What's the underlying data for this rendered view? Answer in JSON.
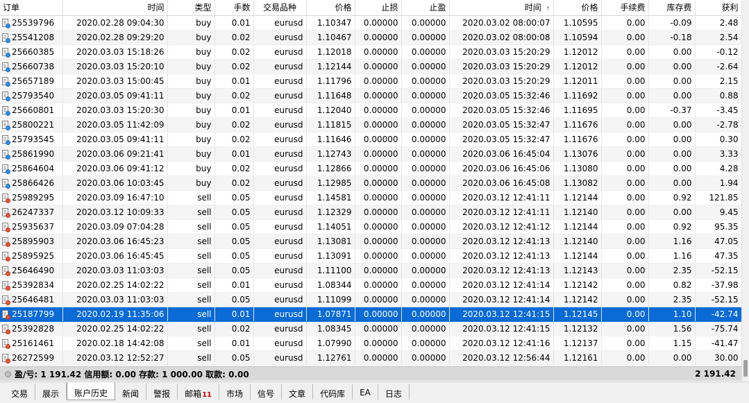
{
  "columns": [
    "订单",
    "时间",
    "类型",
    "手数",
    "交易品种",
    "价格",
    "止损",
    "止盈",
    "时间",
    "价格",
    "手续费",
    "库存费",
    "获利"
  ],
  "sort_indicator": "↑",
  "rows": [
    [
      "25539796",
      "2020.02.28 09:04:30",
      "buy",
      "0.01",
      "eurusd",
      "1.10347",
      "0.00000",
      "0.00000",
      "2020.03.02 08:00:07",
      "1.10595",
      "0.00",
      "-0.09",
      "2.48"
    ],
    [
      "25541208",
      "2020.02.28 09:29:20",
      "buy",
      "0.02",
      "eurusd",
      "1.10467",
      "0.00000",
      "0.00000",
      "2020.03.02 08:00:08",
      "1.10594",
      "0.00",
      "-0.18",
      "2.54"
    ],
    [
      "25660385",
      "2020.03.03 15:18:26",
      "buy",
      "0.02",
      "eurusd",
      "1.12018",
      "0.00000",
      "0.00000",
      "2020.03.03 15:20:29",
      "1.12012",
      "0.00",
      "0.00",
      "-0.12"
    ],
    [
      "25660738",
      "2020.03.03 15:20:10",
      "buy",
      "0.02",
      "eurusd",
      "1.12144",
      "0.00000",
      "0.00000",
      "2020.03.03 15:20:29",
      "1.12012",
      "0.00",
      "0.00",
      "-2.64"
    ],
    [
      "25657189",
      "2020.03.03 15:00:45",
      "buy",
      "0.01",
      "eurusd",
      "1.11796",
      "0.00000",
      "0.00000",
      "2020.03.03 15:20:29",
      "1.12011",
      "0.00",
      "0.00",
      "2.15"
    ],
    [
      "25793540",
      "2020.03.05 09:41:11",
      "buy",
      "0.02",
      "eurusd",
      "1.11648",
      "0.00000",
      "0.00000",
      "2020.03.05 15:32:46",
      "1.11692",
      "0.00",
      "0.00",
      "0.88"
    ],
    [
      "25660801",
      "2020.03.03 15:20:30",
      "buy",
      "0.01",
      "eurusd",
      "1.12040",
      "0.00000",
      "0.00000",
      "2020.03.05 15:32:46",
      "1.11695",
      "0.00",
      "-0.37",
      "-3.45"
    ],
    [
      "25800221",
      "2020.03.05 11:42:09",
      "buy",
      "0.02",
      "eurusd",
      "1.11815",
      "0.00000",
      "0.00000",
      "2020.03.05 15:32:47",
      "1.11676",
      "0.00",
      "0.00",
      "-2.78"
    ],
    [
      "25793545",
      "2020.03.05 09:41:11",
      "buy",
      "0.02",
      "eurusd",
      "1.11646",
      "0.00000",
      "0.00000",
      "2020.03.05 15:32:47",
      "1.11676",
      "0.00",
      "0.00",
      "0.30"
    ],
    [
      "25861990",
      "2020.03.06 09:21:41",
      "buy",
      "0.01",
      "eurusd",
      "1.12743",
      "0.00000",
      "0.00000",
      "2020.03.06 16:45:04",
      "1.13076",
      "0.00",
      "0.00",
      "3.33"
    ],
    [
      "25864604",
      "2020.03.06 09:41:12",
      "buy",
      "0.02",
      "eurusd",
      "1.12866",
      "0.00000",
      "0.00000",
      "2020.03.06 16:45:06",
      "1.13080",
      "0.00",
      "0.00",
      "4.28"
    ],
    [
      "25866426",
      "2020.03.06 10:03:45",
      "buy",
      "0.02",
      "eurusd",
      "1.12985",
      "0.00000",
      "0.00000",
      "2020.03.06 16:45:08",
      "1.13082",
      "0.00",
      "0.00",
      "1.94"
    ],
    [
      "25989295",
      "2020.03.09 16:47:10",
      "sell",
      "0.05",
      "eurusd",
      "1.14581",
      "0.00000",
      "0.00000",
      "2020.03.12 12:41:11",
      "1.12144",
      "0.00",
      "0.92",
      "121.85"
    ],
    [
      "26247337",
      "2020.03.12 10:09:33",
      "sell",
      "0.05",
      "eurusd",
      "1.12329",
      "0.00000",
      "0.00000",
      "2020.03.12 12:41:11",
      "1.12140",
      "0.00",
      "0.00",
      "9.45"
    ],
    [
      "25935637",
      "2020.03.09 07:04:28",
      "sell",
      "0.05",
      "eurusd",
      "1.14051",
      "0.00000",
      "0.00000",
      "2020.03.12 12:41:12",
      "1.12144",
      "0.00",
      "0.92",
      "95.35"
    ],
    [
      "25895903",
      "2020.03.06 16:45:23",
      "sell",
      "0.05",
      "eurusd",
      "1.13081",
      "0.00000",
      "0.00000",
      "2020.03.12 12:41:13",
      "1.12140",
      "0.00",
      "1.16",
      "47.05"
    ],
    [
      "25895925",
      "2020.03.06 16:45:45",
      "sell",
      "0.05",
      "eurusd",
      "1.13091",
      "0.00000",
      "0.00000",
      "2020.03.12 12:41:13",
      "1.12144",
      "0.00",
      "1.16",
      "47.35"
    ],
    [
      "25646490",
      "2020.03.03 11:03:03",
      "sell",
      "0.05",
      "eurusd",
      "1.11100",
      "0.00000",
      "0.00000",
      "2020.03.12 12:41:13",
      "1.12143",
      "0.00",
      "2.35",
      "-52.15"
    ],
    [
      "25392834",
      "2020.02.25 14:02:22",
      "sell",
      "0.01",
      "eurusd",
      "1.08344",
      "0.00000",
      "0.00000",
      "2020.03.12 12:41:14",
      "1.12142",
      "0.00",
      "0.82",
      "-37.98"
    ],
    [
      "25646481",
      "2020.03.03 11:03:03",
      "sell",
      "0.05",
      "eurusd",
      "1.11099",
      "0.00000",
      "0.00000",
      "2020.03.12 12:41:14",
      "1.12142",
      "0.00",
      "2.35",
      "-52.15"
    ],
    [
      "25187799",
      "2020.02.19 11:35:06",
      "sell",
      "0.01",
      "eurusd",
      "1.07871",
      "0.00000",
      "0.00000",
      "2020.03.12 12:41:15",
      "1.12145",
      "0.00",
      "1.10",
      "-42.74"
    ],
    [
      "25392828",
      "2020.02.25 14:02:22",
      "sell",
      "0.02",
      "eurusd",
      "1.08345",
      "0.00000",
      "0.00000",
      "2020.03.12 12:41:15",
      "1.12132",
      "0.00",
      "1.56",
      "-75.74"
    ],
    [
      "25161461",
      "2020.02.18 14:42:08",
      "sell",
      "0.01",
      "eurusd",
      "1.07990",
      "0.00000",
      "0.00000",
      "2020.03.12 12:41:16",
      "1.12137",
      "0.00",
      "1.15",
      "-41.47"
    ],
    [
      "26272599",
      "2020.03.12 12:52:27",
      "sell",
      "0.05",
      "eurusd",
      "1.12761",
      "0.00000",
      "0.00000",
      "2020.03.12 12:56:44",
      "1.12161",
      "0.00",
      "0.00",
      "30.00"
    ]
  ],
  "selected_order": "25187799",
  "summary": {
    "text": "盈/亏: 1 191.42  信用额: 0.00  存款: 1 000.00  取款: 0.00",
    "total": "2 191.42"
  },
  "tabs": [
    {
      "label": "交易"
    },
    {
      "label": "展示"
    },
    {
      "label": "账户历史",
      "active": true
    },
    {
      "label": "新闻"
    },
    {
      "label": "警报"
    },
    {
      "label": "邮箱",
      "badge": "11"
    },
    {
      "label": "市场"
    },
    {
      "label": "信号"
    },
    {
      "label": "文章"
    },
    {
      "label": "代码库"
    },
    {
      "label": "EA"
    },
    {
      "label": "日志"
    }
  ],
  "colors": {
    "selected_row": "#0a6ad6",
    "buy_icon": "#2f8fe6",
    "sell_icon": "#e8563a",
    "badge": "#d00000"
  }
}
